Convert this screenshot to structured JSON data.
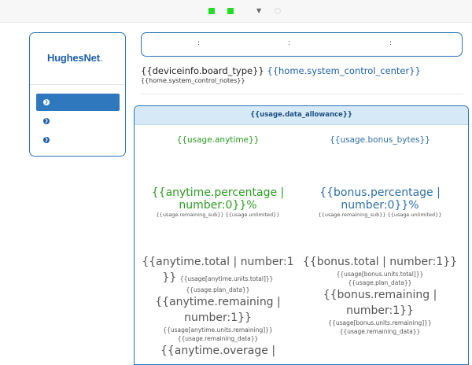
{
  "topbar": {
    "status_icons": [
      "status-led",
      "status-led"
    ],
    "dropdown_icon": "caret-down"
  },
  "brand": {
    "name": "HughesNet",
    "suffix": "."
  },
  "sidebar": {
    "items": [
      {
        "label": ""
      },
      {
        "label": ""
      },
      {
        "label": ""
      }
    ]
  },
  "infobox": {
    "separators": [
      ":",
      ":",
      ":"
    ]
  },
  "header": {
    "board_type": "{{deviceinfo.board_type}}",
    "control_center": "{{home.system_control_center}}",
    "notes": "{{home.system_control_notes}}"
  },
  "usage": {
    "title": "{{usage.data_allowance}}",
    "anytime": {
      "title": "{{usage.anytime}}",
      "percentage": "{{anytime.percentage | number:0}}%",
      "remaining_sub": "{{usage.remaining_sub}}",
      "unlimited": "{{usage.unlimited}}",
      "total": "{{anytime.total | number:1 }}",
      "total_units": "{{usage[anytime.units.total]}}",
      "plan_data": "{{usage.plan_data}}",
      "remaining": "{{anytime.remaining | number:1}}",
      "remaining_units": "{{usage[anytime.units.remaining]}}",
      "remaining_data": "{{usage.remaining_data}}",
      "overage": "{{anytime.overage |"
    },
    "bonus": {
      "title": "{{usage.bonus_bytes}}",
      "percentage": "{{bonus.percentage | number:0}}%",
      "remaining_sub": "{{usage.remaining_sub}}",
      "unlimited": "{{usage.unlimited}}",
      "total": "{{bonus.total | number:1}}",
      "total_units": "{{usage[bonus.units.total]}}",
      "plan_data": "{{usage.plan_data}}",
      "remaining": "{{bonus.remaining | number:1}}",
      "remaining_units": "{{usage[bonus.units.remaining]}}",
      "remaining_data": "{{usage.remaining_data}}"
    }
  },
  "colors": {
    "accent": "#2e73b5",
    "anytime": "#2a9a22",
    "bonus": "#2e6fa6",
    "panel_head_bg": "#d6e9f7",
    "led": "#22dd22"
  }
}
